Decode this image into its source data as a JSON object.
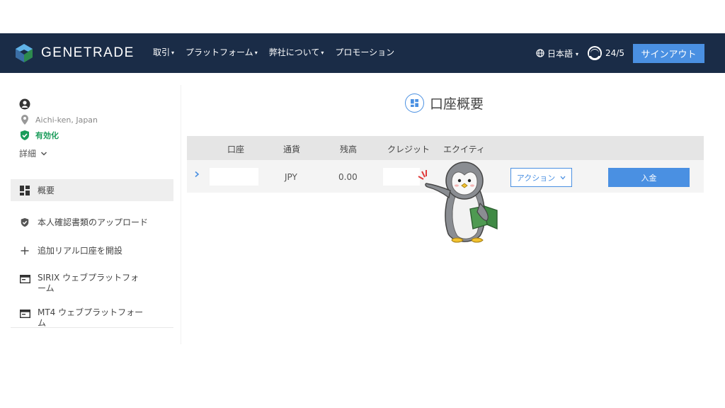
{
  "header": {
    "logo_text": "GENETRADE",
    "nav": [
      {
        "label": "取引"
      },
      {
        "label": "プラットフォーム"
      },
      {
        "label": "弊社について"
      },
      {
        "label": "プロモーション"
      }
    ],
    "language": "日本語",
    "support": "24/5",
    "signout": "サインアウト"
  },
  "profile": {
    "location": "Aichi-ken, Japan",
    "status": "有効化",
    "details": "詳細"
  },
  "sidebar": {
    "items": [
      {
        "label": "概要"
      },
      {
        "label": "本人確認書類のアップロード"
      },
      {
        "label": "追加リアル口座を開設"
      },
      {
        "label": "SIRIX ウェブプラットフォーム"
      },
      {
        "label": "MT4 ウェブプラットフォーム"
      }
    ]
  },
  "main": {
    "title": "口座概要",
    "columns": [
      "口座",
      "通貨",
      "残高",
      "クレジット",
      "エクイティ"
    ],
    "row": {
      "currency": "JPY",
      "balance": "0.00"
    },
    "action_label": "アクション",
    "deposit_label": "入金"
  },
  "colors": {
    "header_bg": "#1a2c47",
    "accent": "#4a90e2",
    "verified": "#1a9c5a"
  }
}
